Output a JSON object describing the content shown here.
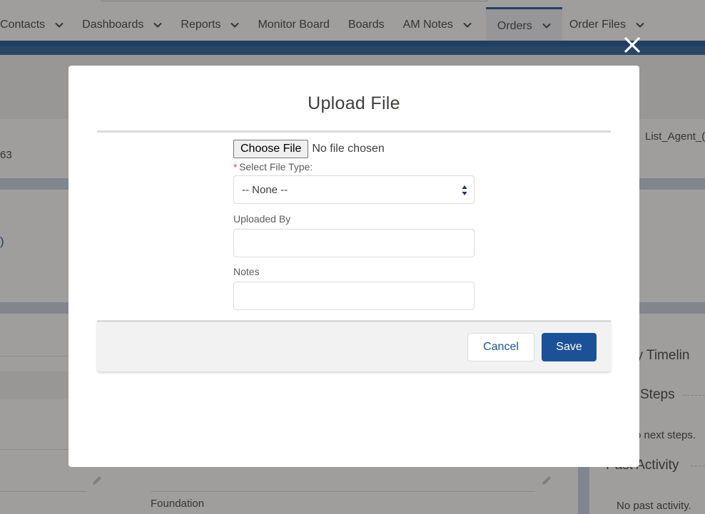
{
  "nav": {
    "items": [
      {
        "label": "Contacts",
        "has_menu": true
      },
      {
        "label": "Dashboards",
        "has_menu": true
      },
      {
        "label": "Reports",
        "has_menu": true
      },
      {
        "label": "Monitor Board",
        "has_menu": false
      },
      {
        "label": "Boards",
        "has_menu": false
      },
      {
        "label": "AM Notes",
        "has_menu": true
      },
      {
        "label": "Orders",
        "has_menu": true,
        "active": true
      },
      {
        "label": "Order Files",
        "has_menu": true
      }
    ]
  },
  "background": {
    "record_number_fragment": "63",
    "link_fragment": ")",
    "field_label_fragment": "List_Agent_(",
    "foundation_text": "Foundation",
    "activity": {
      "timeline_title": "ity Timelin",
      "next_steps_title": "Steps",
      "next_steps_empty": "o next steps.",
      "past_activity_title": "Past Activity",
      "past_activity_empty": "No past activity."
    }
  },
  "modal": {
    "title": "Upload File",
    "close_icon": "close-icon",
    "file_input": {
      "button_label": "Choose File",
      "status": "No file chosen"
    },
    "file_type": {
      "required_marker": "*",
      "label": "Select File Type:",
      "selected": "-- None --"
    },
    "uploaded_by": {
      "label": "Uploaded By",
      "value": ""
    },
    "notes": {
      "label": "Notes",
      "value": ""
    },
    "buttons": {
      "cancel": "Cancel",
      "save": "Save"
    }
  },
  "colors": {
    "brand": "#1b5297",
    "required": "#c23934",
    "overlay": "#2b2826"
  }
}
